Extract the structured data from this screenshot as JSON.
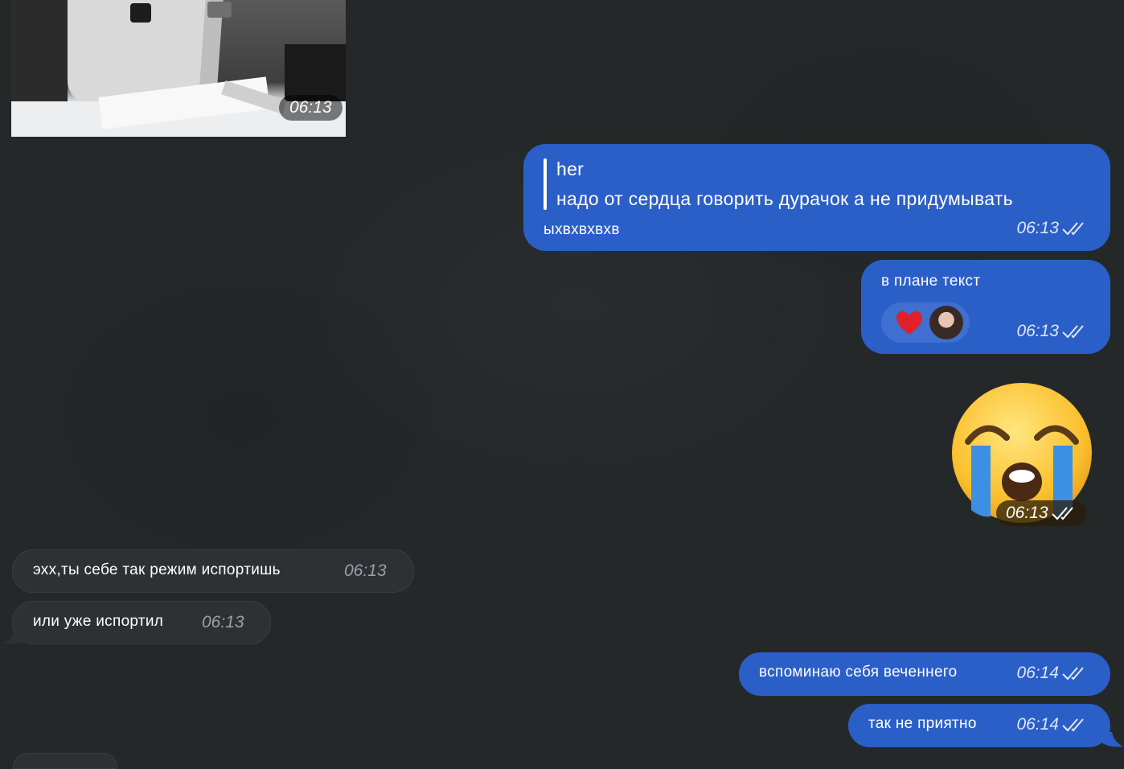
{
  "media_message": {
    "time": "06:13"
  },
  "messages": {
    "reply_msg": {
      "quote_author": "her",
      "quote_text": "надо от сердца говорить дурачок а не придумывать",
      "text": "ыхвхвхвхв",
      "time": "06:13",
      "status_icon": "double-check-icon"
    },
    "plan_msg": {
      "text": "в плане текст",
      "reaction": "red-heart",
      "time": "06:13",
      "status_icon": "double-check-icon"
    },
    "emoji_msg": {
      "emoji": "loudly-crying-face",
      "time": "06:13",
      "status_icon": "double-check-icon"
    },
    "in_msg_1": {
      "text": "эхх,ты себе так режим испортишь",
      "time": "06:13"
    },
    "in_msg_2": {
      "text": "или уже испортил",
      "time": "06:13"
    },
    "out_msg_1": {
      "text": "вспоминаю себя веченнего",
      "time": "06:14",
      "status_icon": "double-check-icon"
    },
    "out_msg_2": {
      "text": "так не приятно",
      "time": "06:14",
      "status_icon": "double-check-icon"
    }
  },
  "colors": {
    "background": "#242829",
    "outgoing_bubble": "#2b5fc8",
    "incoming_bubble": "#2e3133"
  }
}
